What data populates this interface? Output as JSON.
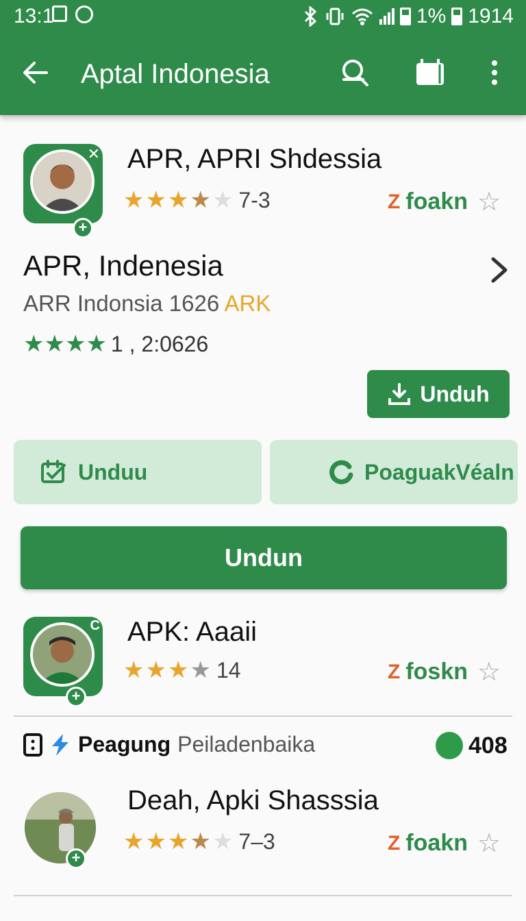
{
  "status_bar": {
    "time": "13:1",
    "battery_text": "1%",
    "right_number": "1914"
  },
  "app_bar": {
    "title": "Aptal Indonesia"
  },
  "listing_1": {
    "title": "APR, APRI Shdessia",
    "rating_text": "7-3",
    "tag_label": "foakn",
    "stars_filled": 3.5
  },
  "detail": {
    "title": "APR, Indenesia",
    "subtitle": "ARR Indonsia 1626 ",
    "subtitle_accent": "ARK",
    "rating_text": "1 , 2:0626",
    "download_button": "Unduh",
    "action_1": "Unduu",
    "action_2": "PoaguakVéaln",
    "main_button": "Undun"
  },
  "listing_2": {
    "title": "APK: Aaaii",
    "rating_text": "14",
    "tag_label": "foskn",
    "stars_filled": 3
  },
  "section": {
    "label_strong": "Peagung",
    "label_light": "Peiladenbaika",
    "count": "408"
  },
  "listing_3": {
    "title": "Deah, Apki Shasssia",
    "rating_text": "7–3",
    "tag_label": "foakn",
    "stars_filled": 3.5
  },
  "colors": {
    "primary_green": "#2e8b4a",
    "soft_green": "#d2ebd9",
    "star_gold": "#e7a62b",
    "tag_orange": "#e0612a"
  }
}
